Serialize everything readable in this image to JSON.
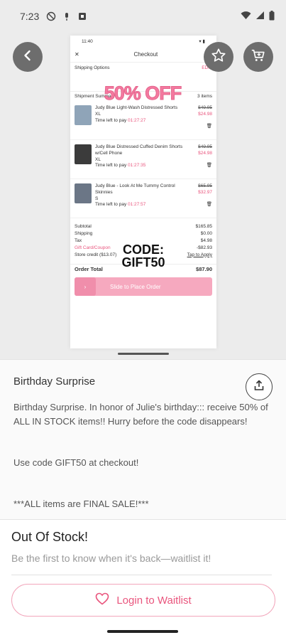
{
  "status_bar": {
    "time": "7:23"
  },
  "screenshot": {
    "status_time": "11:40",
    "header": {
      "close": "✕",
      "title": "Checkout"
    },
    "shipping_options": {
      "label": "Shipping Options",
      "action": "EDIT"
    },
    "promo_banner": "50% OFF",
    "shipment_summary": {
      "label": "Shipment Summary",
      "count": "3 items"
    },
    "items": [
      {
        "name": "Judy Blue Light-Wash Distressed Shorts",
        "variant": "XL",
        "timer_label": "Time left to pay",
        "timer": "01:27:27",
        "old_price": "$49.95",
        "price": "$24.98"
      },
      {
        "name": "Judy Blue Distressed Cuffed Denim Shorts w/Cell Phone",
        "variant": "XL",
        "timer_label": "Time left to pay",
        "timer": "01:27:35",
        "old_price": "$49.95",
        "price": "$24.98"
      },
      {
        "name": "Judy Blue - Look At Me Tummy Control Skinnies",
        "variant": "S",
        "timer_label": "Time left to pay",
        "timer": "01:27:57",
        "old_price": "$65.95",
        "price": "$32.97"
      }
    ],
    "code_banner_line1": "CODE:",
    "code_banner_line2": "GIFT50",
    "summary": [
      {
        "label": "Subtotal",
        "value": "$165.85"
      },
      {
        "label": "Shipping",
        "value": "$0.00"
      },
      {
        "label": "Tax",
        "value": "$4.98"
      },
      {
        "label": "Gift Card/Coupon",
        "value": "-$82.93"
      }
    ],
    "store_credit": {
      "label": "Store credit ($13.07)",
      "action": "Tap to Apply"
    },
    "order_total": {
      "label": "Order Total",
      "value": "$87.90"
    },
    "slide_label": "Slide to Place Order"
  },
  "description": {
    "title": "Birthday Surprise",
    "paragraphs": [
      "Birthday Surprise. In honor of Julie's birthday::: receive 50% of ALL IN STOCK items!! Hurry before the code disappears!",
      "Use code GIFT50 at checkout!",
      "***ALL items are FINAL SALE!***"
    ]
  },
  "stock": {
    "title": "Out Of Stock!",
    "subtitle": "Be the first to know when it's back—waitlist it!",
    "button_label": "Login to Waitlist"
  },
  "icons": {
    "back": "arrow-left-icon",
    "favorite": "star-icon",
    "cart": "cart-icon",
    "share": "share-icon",
    "heart": "heart-icon"
  },
  "colors": {
    "accent": "#e9557d",
    "button_grey": "#6d6d6d"
  }
}
